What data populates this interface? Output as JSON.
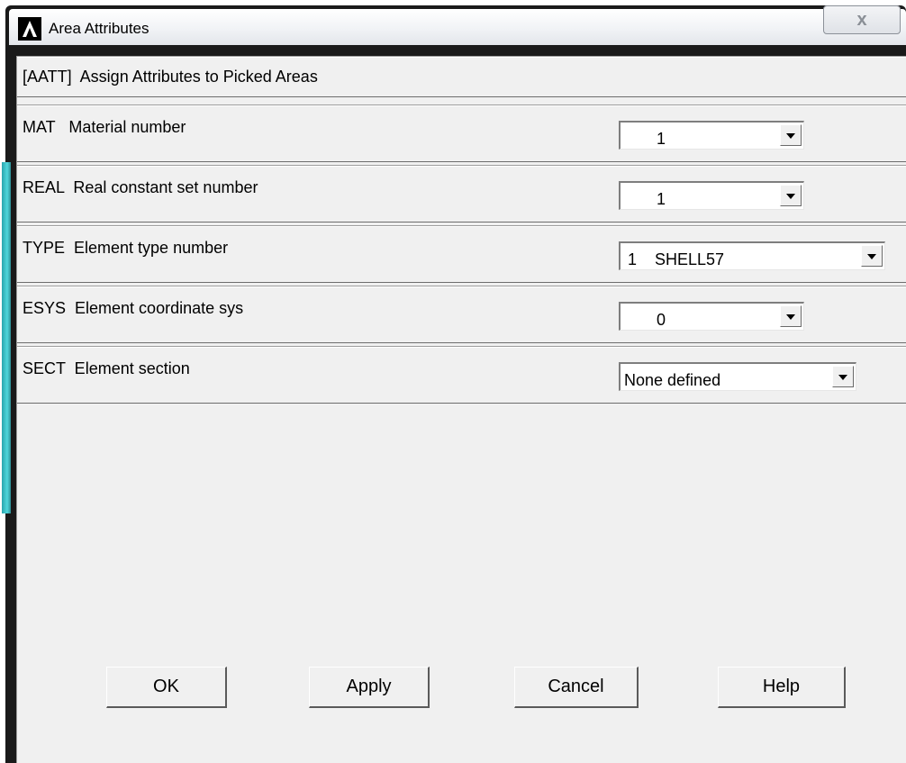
{
  "window": {
    "title": "Area Attributes",
    "close_glyph": "x",
    "icon": "ansys-logo-icon"
  },
  "dialog": {
    "heading": "[AATT]  Assign Attributes to Picked Areas",
    "fields": [
      {
        "label": "MAT   Material number",
        "value": "1"
      },
      {
        "label": "REAL  Real constant set number",
        "value": "1"
      },
      {
        "label": "TYPE  Element type number",
        "value": "1    SHELL57"
      },
      {
        "label": "ESYS  Element coordinate sys",
        "value": "0"
      },
      {
        "label": "SECT  Element section",
        "value": "None defined"
      }
    ],
    "buttons": {
      "ok": "OK",
      "apply": "Apply",
      "cancel": "Cancel",
      "help": "Help"
    }
  },
  "colors": {
    "frame": "#1a1a1a",
    "dialog_bg": "#f0f0f0",
    "glow_accent": "#4fd6dc"
  }
}
